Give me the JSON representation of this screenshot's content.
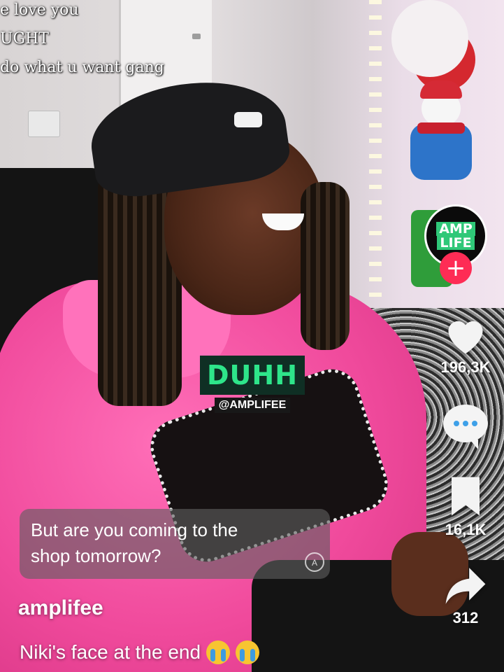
{
  "overlay_caption_lines": [
    "e love you",
    "UGHT",
    "do what u want gang"
  ],
  "watermark": {
    "big": "DUHH",
    "handle": "@AMPLIFEE"
  },
  "profile": {
    "avatar_text": [
      "AMP",
      "LIFE"
    ],
    "follow_symbol": "+"
  },
  "actions": {
    "likes": "196,3K",
    "bookmarks": "16,1K",
    "shares": "312"
  },
  "question_sticker": {
    "text_line1": "But are you coming to the",
    "text_line2": "shop tomorrow?",
    "translate_icon": "A"
  },
  "post": {
    "username": "amplifee",
    "description": "Niki's face at the end"
  },
  "colors": {
    "accent_red": "#fe2c55",
    "brand_green": "#2ee58a",
    "hoodie_pink": "#f04a9c"
  },
  "icons": [
    "heart-icon",
    "comment-icon",
    "bookmark-icon",
    "share-icon",
    "translate-icon",
    "loudly-crying-emoji"
  ]
}
